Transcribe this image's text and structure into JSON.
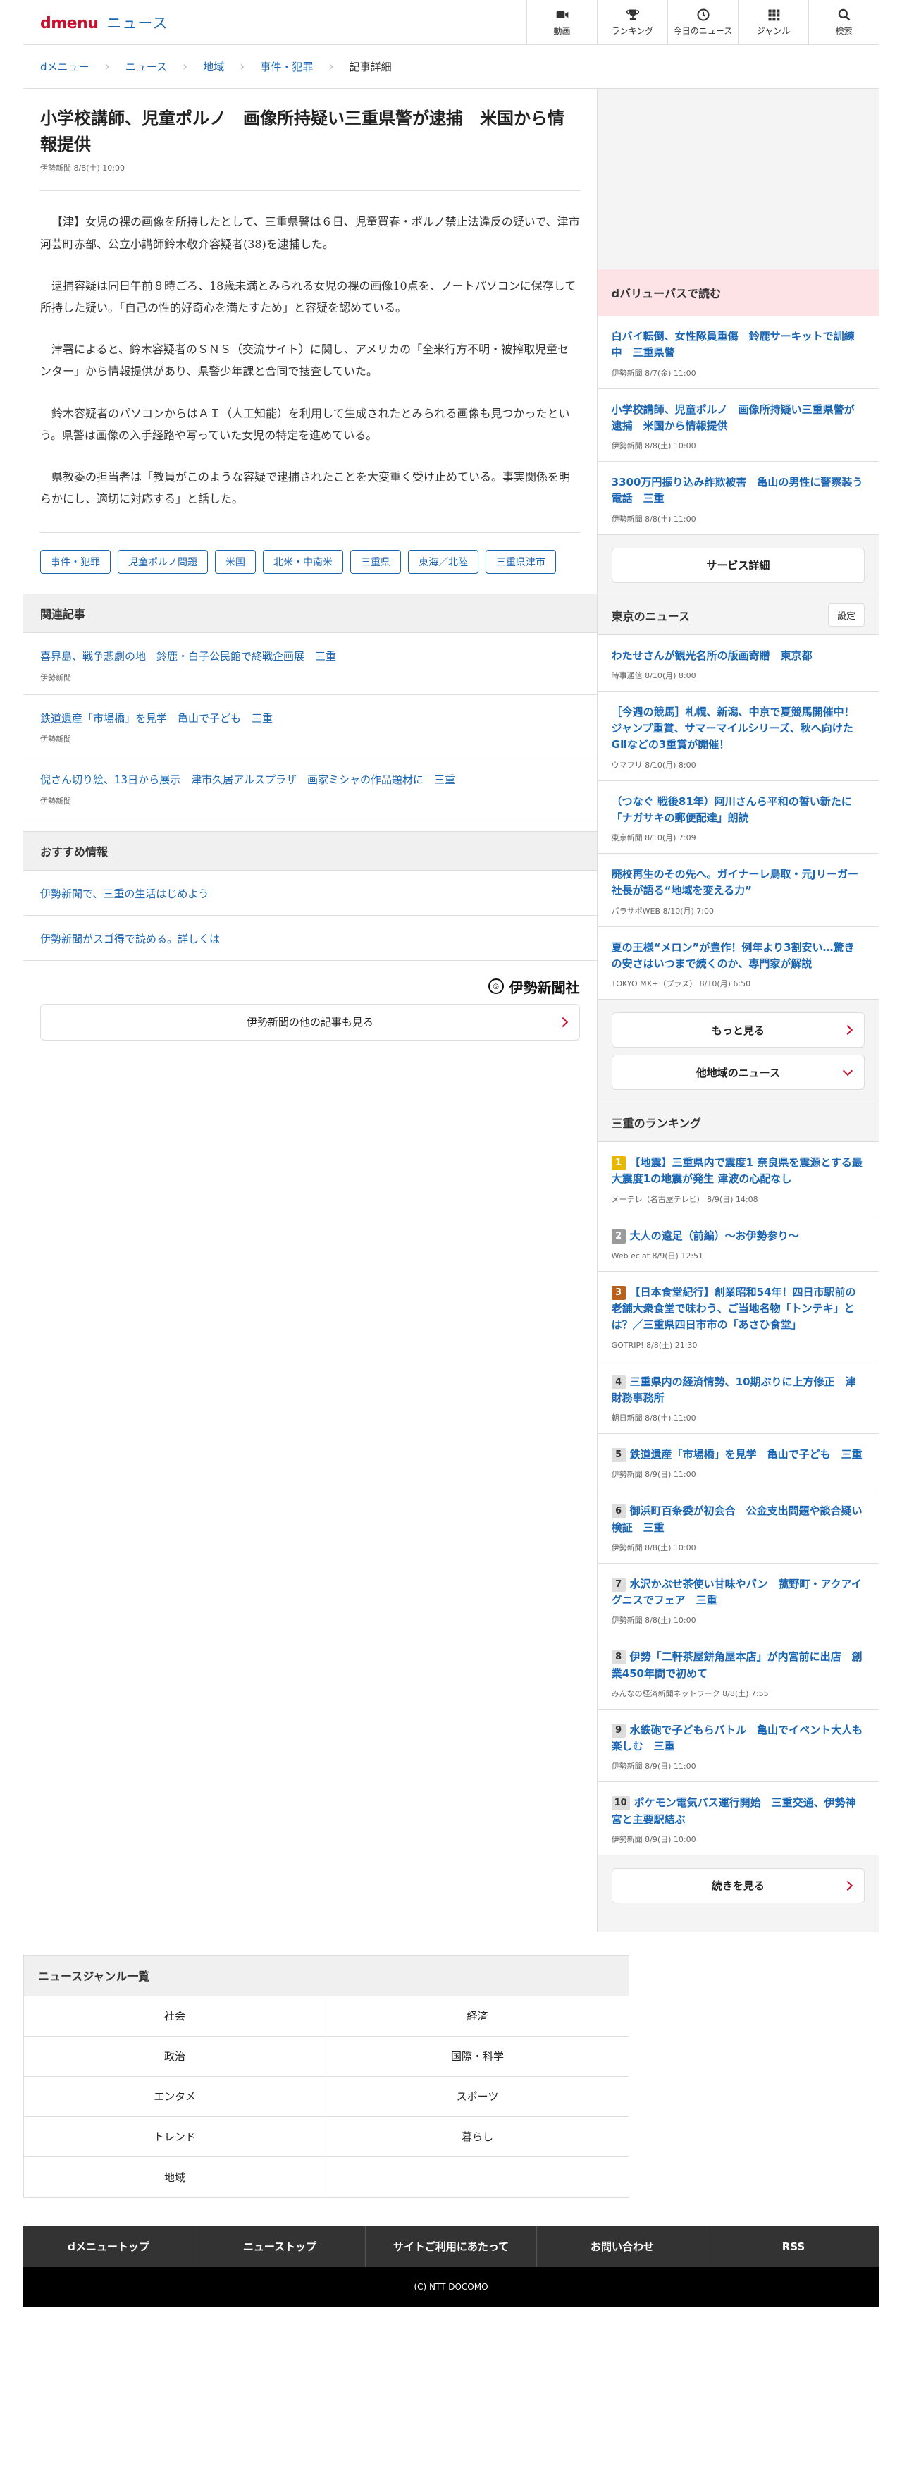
{
  "header": {
    "brand": "dmenu",
    "section": "ニュース",
    "nav": [
      {
        "label": "動画",
        "icon": "video-icon"
      },
      {
        "label": "ランキング",
        "icon": "trophy-icon"
      },
      {
        "label": "今日のニュース",
        "icon": "clock-icon"
      },
      {
        "label": "ジャンル",
        "icon": "grid-icon"
      },
      {
        "label": "検索",
        "icon": "search-icon"
      }
    ]
  },
  "breadcrumb": [
    "dメニュー",
    "ニュース",
    "地域",
    "事件・犯罪",
    "記事詳細"
  ],
  "article": {
    "title": "小学校講師、児童ポルノ　画像所持疑い三重県警が逮捕　米国から情報提供",
    "meta": "伊勢新聞 8/8(土) 10:00",
    "paragraphs": [
      "【津】女児の裸の画像を所持したとして、三重県警は６日、児童買春・ポルノ禁止法違反の疑いで、津市河芸町赤部、公立小講師鈴木敬介容疑者(38)を逮捕した。",
      "逮捕容疑は同日午前８時ごろ、18歳未満とみられる女児の裸の画像10点を、ノートパソコンに保存して所持した疑い。「自己の性的好奇心を満たすため」と容疑を認めている。",
      "津署によると、鈴木容疑者のＳＮＳ（交流サイト）に関し、アメリカの「全米行方不明・被搾取児童センター」から情報提供があり、県警少年課と合同で捜査していた。",
      "鈴木容疑者のパソコンからはＡＩ（人工知能）を利用して生成されたとみられる画像も見つかったという。県警は画像の入手経路や写っていた女児の特定を進めている。",
      "県教委の担当者は「教員がこのような容疑で逮捕されたことを大変重く受け止めている。事実関係を明らかにし、適切に対応する」と話した。"
    ],
    "tags": [
      "事件・犯罪",
      "児童ポルノ問題",
      "米国",
      "北米・中南米",
      "三重県",
      "東海／北陸",
      "三重県津市"
    ]
  },
  "related": {
    "heading": "関連記事",
    "items": [
      {
        "title": "喜界島、戦争悲劇の地　鈴鹿・白子公民館で終戦企画展　三重",
        "source": "伊勢新聞"
      },
      {
        "title": "鉄道遺産「市場橋」を見学　亀山で子ども　三重",
        "source": "伊勢新聞"
      },
      {
        "title": "倪さん切り絵、13日から展示　津市久居アルスプラザ　画家ミシャの作品題材に　三重",
        "source": "伊勢新聞"
      }
    ]
  },
  "recommend": {
    "heading": "おすすめ情報",
    "items": [
      "伊勢新聞で、三重の生活はじめよう",
      "伊勢新聞がスゴ得で読める。詳しくは"
    ]
  },
  "publisher": {
    "name": "伊勢新聞社",
    "more": "伊勢新聞の他の記事も見る"
  },
  "sidebar": {
    "dvalue": {
      "heading": "dバリューパスで読む",
      "items": [
        {
          "title": "白バイ転倒、女性隊員重傷　鈴鹿サーキットで訓練中　三重県警",
          "source": "伊勢新聞 8/7(金) 11:00"
        },
        {
          "title": "小学校講師、児童ポルノ　画像所持疑い三重県警が逮捕　米国から情報提供",
          "source": "伊勢新聞 8/8(土) 10:00"
        },
        {
          "title": "3300万円振り込み詐欺被害　亀山の男性に警察装う電話　三重",
          "source": "伊勢新聞 8/8(土) 11:00"
        }
      ],
      "button": "サービス詳細"
    },
    "tokyo": {
      "heading": "東京のニュース",
      "settings": "設定",
      "items": [
        {
          "title": "わたせさんが観光名所の版画寄贈　東京都",
          "source": "時事通信 8/10(月) 8:00"
        },
        {
          "title": "［今週の競馬］札幌、新潟、中京で夏競馬開催中！ジャンプ重賞、サマーマイルシリーズ、秋へ向けたGⅡなどの3重賞が開催！",
          "source": "ウマフリ 8/10(月) 8:00"
        },
        {
          "title": "（つなぐ 戦後81年）阿川さんら平和の誓い新たに「ナガサキの郵便配達」朗読",
          "source": "東京新聞 8/10(月) 7:09"
        },
        {
          "title": "廃校再生のその先へ。ガイナーレ鳥取・元Jリーガー社長が語る“地域を変える力”",
          "source": "パラサポWEB 8/10(月) 7:00"
        },
        {
          "title": "夏の王様“メロン”が豊作！例年より3割安い…驚きの安さはいつまで続くのか、専門家が解説",
          "source": "TOKYO MX+（プラス） 8/10(月) 6:50"
        }
      ],
      "more": "もっと見る",
      "other": "他地域のニュース"
    },
    "ranking": {
      "heading": "三重のランキング",
      "items": [
        {
          "rank": "1",
          "title": "【地震】三重県内で震度1 奈良県を震源とする最大震度1の地震が発生 津波の心配なし",
          "source": "メーテレ（名古屋テレビ） 8/9(日) 14:08"
        },
        {
          "rank": "2",
          "title": "大人の遠足（前編）～お伊勢参り～",
          "source": "Web eclat 8/9(日) 12:51"
        },
        {
          "rank": "3",
          "title": "【日本食堂紀行】創業昭和54年！四日市駅前の老舗大衆食堂で味わう、ご当地名物「トンテキ」とは？／三重県四日市市の「あさひ食堂」",
          "source": "GOTRIP! 8/8(土) 21:30"
        },
        {
          "rank": "4",
          "title": "三重県内の経済情勢、10期ぶりに上方修正　津財務事務所",
          "source": "朝日新聞 8/8(土) 11:00"
        },
        {
          "rank": "5",
          "title": "鉄道遺産「市場橋」を見学　亀山で子ども　三重",
          "source": "伊勢新聞 8/9(日) 11:00"
        },
        {
          "rank": "6",
          "title": "御浜町百条委が初会合　公金支出問題や談合疑い検証　三重",
          "source": "伊勢新聞 8/8(土) 10:00"
        },
        {
          "rank": "7",
          "title": "水沢かぶせ茶使い甘味やパン　菰野町・アクアイグニスでフェア　三重",
          "source": "伊勢新聞 8/8(土) 10:00"
        },
        {
          "rank": "8",
          "title": "伊勢「二軒茶屋餅角屋本店」が内宮前に出店　創業450年間で初めて",
          "source": "みんなの経済新聞ネットワーク 8/8(土) 7:55"
        },
        {
          "rank": "9",
          "title": "水鉄砲で子どもらバトル　亀山でイベント大人も楽しむ　三重",
          "source": "伊勢新聞 8/9(日) 11:00"
        },
        {
          "rank": "10",
          "title": "ポケモン電気バス運行開始　三重交通、伊勢神宮と主要駅結ぶ",
          "source": "伊勢新聞 8/9(日) 10:00"
        }
      ],
      "more": "続きを見る"
    }
  },
  "genres": {
    "heading": "ニュースジャンル一覧",
    "items": [
      "社会",
      "経済",
      "政治",
      "国際・科学",
      "エンタメ",
      "スポーツ",
      "トレンド",
      "暮らし",
      "地域",
      ""
    ]
  },
  "footer": {
    "links": [
      "dメニュートップ",
      "ニューストップ",
      "サイトご利用にあたって",
      "お問い合わせ",
      "RSS"
    ],
    "copyright": "(C) NTT DOCOMO"
  }
}
